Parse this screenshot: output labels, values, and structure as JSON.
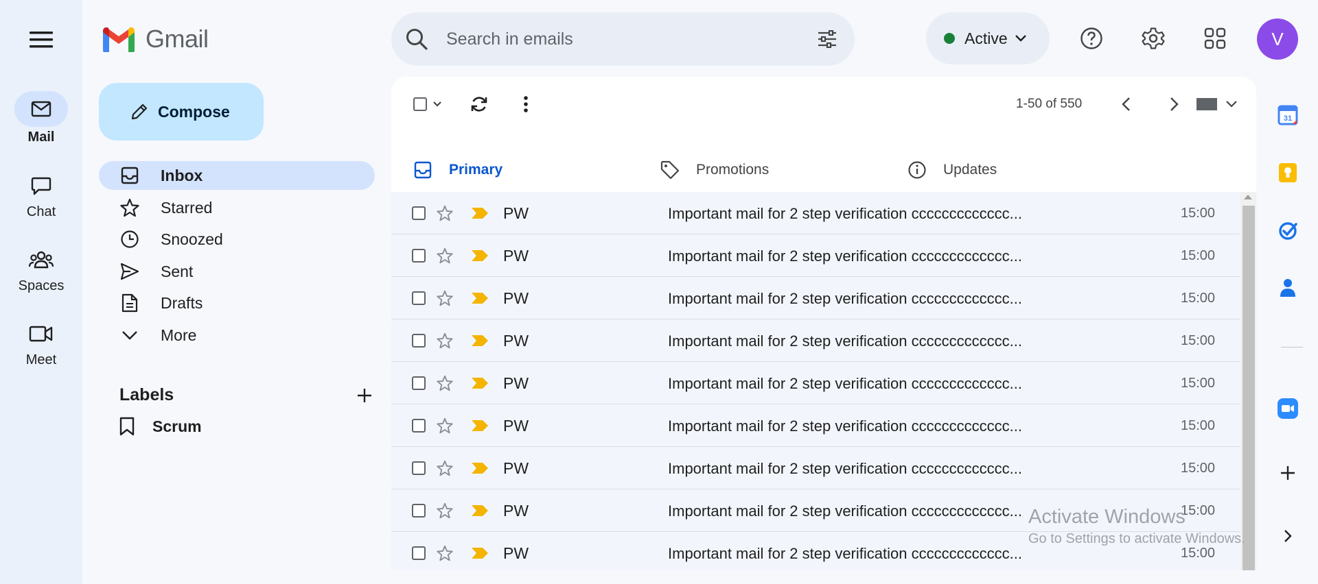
{
  "app": {
    "logo_text": "Gmail"
  },
  "rail": {
    "items": [
      {
        "label": "Mail",
        "icon": "mail-icon"
      },
      {
        "label": "Chat",
        "icon": "chat-icon"
      },
      {
        "label": "Spaces",
        "icon": "spaces-icon"
      },
      {
        "label": "Meet",
        "icon": "meet-icon"
      }
    ]
  },
  "sidebar": {
    "compose_label": "Compose",
    "items": [
      {
        "label": "Inbox",
        "icon": "inbox-icon"
      },
      {
        "label": "Starred",
        "icon": "star-icon"
      },
      {
        "label": "Snoozed",
        "icon": "clock-icon"
      },
      {
        "label": "Sent",
        "icon": "send-icon"
      },
      {
        "label": "Drafts",
        "icon": "draft-icon"
      },
      {
        "label": "More",
        "icon": "chevron-down-icon"
      }
    ],
    "labels_title": "Labels",
    "labels": [
      {
        "label": "Scrum",
        "icon": "label-icon"
      }
    ]
  },
  "search": {
    "placeholder": "Search in emails"
  },
  "status": {
    "label": "Active",
    "color": "#188038"
  },
  "avatar": {
    "initial": "V",
    "color": "#8b4be8"
  },
  "toolbar": {
    "pager": "1-50 of 550"
  },
  "tabs": [
    {
      "label": "Primary",
      "icon": "inbox-icon",
      "active": true
    },
    {
      "label": "Promotions",
      "icon": "tag-icon",
      "active": false
    },
    {
      "label": "Updates",
      "icon": "info-icon",
      "active": false
    }
  ],
  "emails": [
    {
      "sender": "PW",
      "subject": "Important mail for 2 step verification ccccccccccccc...",
      "time": "15:00"
    },
    {
      "sender": "PW",
      "subject": "Important mail for 2 step verification ccccccccccccc...",
      "time": "15:00"
    },
    {
      "sender": "PW",
      "subject": "Important mail for 2 step verification ccccccccccccc...",
      "time": "15:00"
    },
    {
      "sender": "PW",
      "subject": "Important mail for 2 step verification ccccccccccccc...",
      "time": "15:00"
    },
    {
      "sender": "PW",
      "subject": "Important mail for 2 step verification ccccccccccccc...",
      "time": "15:00"
    },
    {
      "sender": "PW",
      "subject": "Important mail for 2 step verification ccccccccccccc...",
      "time": "15:00"
    },
    {
      "sender": "PW",
      "subject": "Important mail for 2 step verification ccccccccccccc...",
      "time": "15:00"
    },
    {
      "sender": "PW",
      "subject": "Important mail for 2 step verification ccccccccccccc...",
      "time": "15:00"
    },
    {
      "sender": "PW",
      "subject": "Important mail for 2 step verification ccccccccccccc...",
      "time": "15:00"
    }
  ],
  "watermark": {
    "title": "Activate Windows",
    "subtitle": "Go to Settings to activate Windows."
  },
  "colors": {
    "accent": "#0b57d0",
    "importance": "#f4b400",
    "row_bg": "#f2f6fc"
  }
}
